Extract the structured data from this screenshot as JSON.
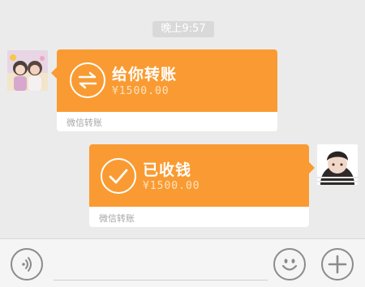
{
  "timestamp": "晚上9:57",
  "messages": [
    {
      "direction": "incoming",
      "title": "给你转账",
      "amount": "¥1500.00",
      "footer": "微信转账",
      "icon": "transfer-arrows-icon"
    },
    {
      "direction": "outgoing",
      "title": "已收钱",
      "amount": "¥1500.00",
      "footer": "微信转账",
      "icon": "checkmark-icon"
    }
  ],
  "input_bar": {
    "voice_icon": "voice-icon",
    "emoji_icon": "emoji-icon",
    "plus_icon": "plus-icon",
    "placeholder": ""
  },
  "colors": {
    "transfer_orange": "#f99b32",
    "chat_background": "#ebebeb",
    "footer_text": "#a7a7a7"
  }
}
